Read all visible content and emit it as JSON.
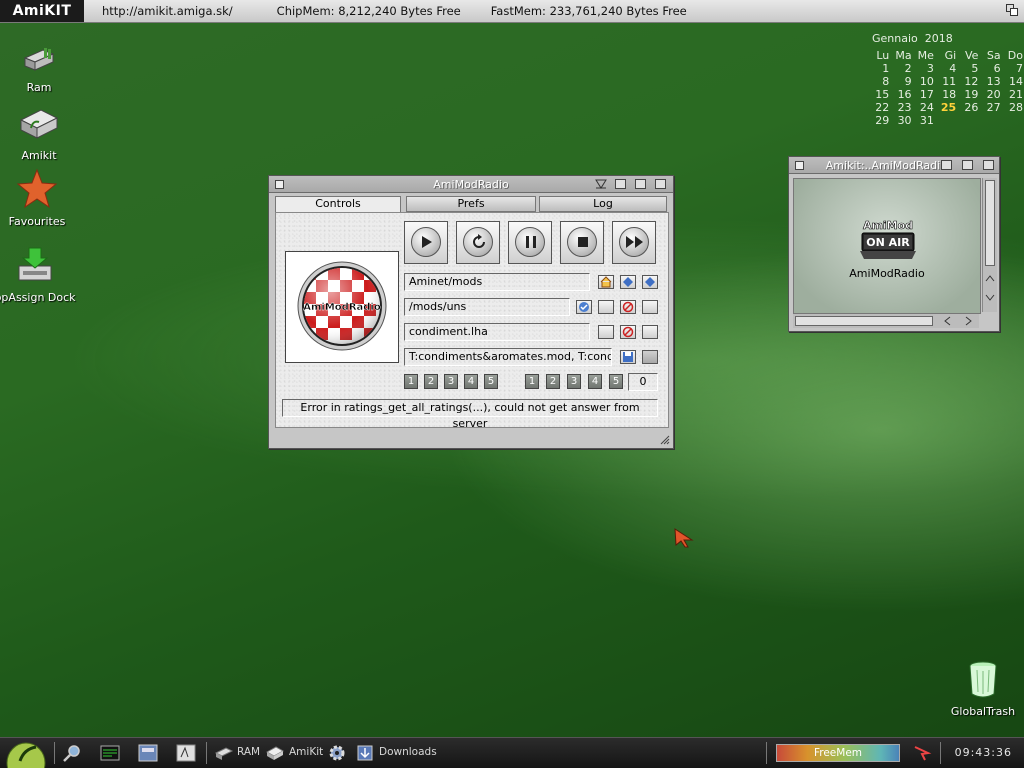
{
  "topbar": {
    "logo": "AmiKIT",
    "url": "http://amikit.amiga.sk/",
    "chipmem": "ChipMem: 8,212,240 Bytes Free",
    "fastmem": "FastMem: 233,761,240 Bytes Free"
  },
  "desktop_icons": {
    "ram": "Ram",
    "amikit": "Amikit",
    "favourites": "Favourites",
    "appassign": "ppAssign Dock",
    "trash": "GlobalTrash"
  },
  "calendar": {
    "month": "Gennaio",
    "year": "2018",
    "days": [
      "Lu",
      "Ma",
      "Me",
      "Gi",
      "Ve",
      "Sa",
      "Do"
    ],
    "weeks": [
      [
        "1",
        "2",
        "3",
        "4",
        "5",
        "6",
        "7"
      ],
      [
        "8",
        "9",
        "10",
        "11",
        "12",
        "13",
        "14"
      ],
      [
        "15",
        "16",
        "17",
        "18",
        "19",
        "20",
        "21"
      ],
      [
        "22",
        "23",
        "24",
        "25",
        "26",
        "27",
        "28"
      ],
      [
        "29",
        "30",
        "31",
        "",
        "",
        "",
        ""
      ]
    ],
    "today": "25"
  },
  "amimodradio": {
    "title": "AmiModRadio",
    "tabs": [
      "Controls",
      "Prefs",
      "Log"
    ],
    "cover_text": "AmiModRadio",
    "path1": "Aminet/mods",
    "path2": "/mods/uns",
    "file": "condiment.lha",
    "playlist": "T:condiments&aromates.mod, T:cond",
    "ratings_a": [
      "1",
      "2",
      "3",
      "4",
      "5"
    ],
    "ratings_b": [
      "1",
      "2",
      "3",
      "4",
      "5"
    ],
    "counter": "0",
    "status": "Error in ratings_get_all_ratings(...), could not get answer from server"
  },
  "smallwin": {
    "title": "Amikit:..AmiModRadi",
    "logo_line1": "AmiMod",
    "logo_line2": "ON AIR",
    "label": "AmiModRadio"
  },
  "taskbar": {
    "ram": "RAM",
    "amikit": "AmiKit",
    "downloads": "Downloads",
    "freemem": "FreeMem",
    "clock": "09:43:36"
  },
  "colors": {
    "desktop": "#2a6a22",
    "today": "#ffd23a"
  }
}
